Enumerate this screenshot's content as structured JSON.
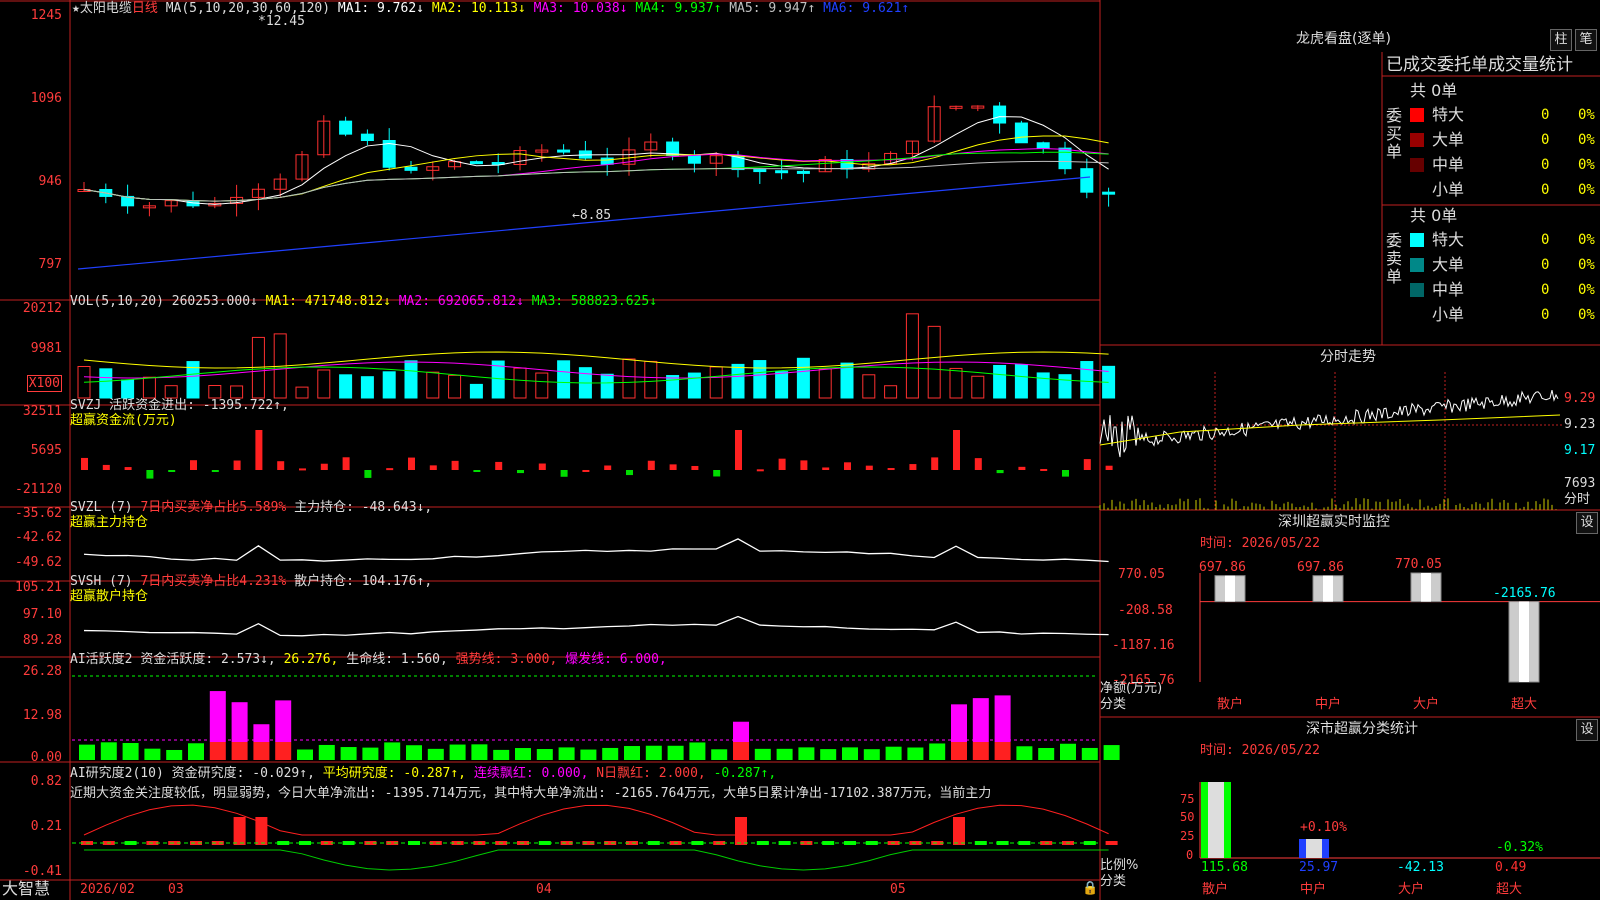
{
  "stock": {
    "name": "太阳电缆",
    "period": "日线"
  },
  "main_chart": {
    "ma_label": "MA(5,10,20,30,60,120)",
    "ma_values": [
      {
        "name": "MA1:",
        "value": "9.762↓",
        "color": "#ffffff"
      },
      {
        "name": "MA2:",
        "value": "10.113↓",
        "color": "#ffff00"
      },
      {
        "name": "MA3:",
        "value": "10.038↓",
        "color": "#ff00ff"
      },
      {
        "name": "MA4:",
        "value": "9.937↑",
        "color": "#00ff00"
      },
      {
        "name": "MA5:",
        "value": "9.947↑",
        "color": "#c0c0c0"
      },
      {
        "name": "MA6:",
        "value": "9.621↑",
        "color": "#2040ff"
      }
    ],
    "axis": [
      "1245",
      "1096",
      "946",
      "797"
    ],
    "high_label": "12.45",
    "low_label": "8.85"
  },
  "vol_panel": {
    "label": "VOL(5,10,20)",
    "value": "260253.000↓",
    "ma1": "MA1: 471748.812↓",
    "ma2": "MA2: 692065.812↓",
    "ma3": "MA3: 588823.625↓",
    "axis": [
      "20212",
      "9981"
    ],
    "unit": "X100"
  },
  "svzj_panel": {
    "line1": "SVZJ  活跃资金进出: -1395.722↑,",
    "line2": "超赢资金流(万元)",
    "axis": [
      "32511",
      "5695",
      "-21120"
    ]
  },
  "svzl_panel": {
    "prefix": "SVZL (7)",
    "ratio": "7日内买卖净占比5.589%",
    "hold": "主力持仓: -48.643↓,",
    "line2": "超赢主力持仓",
    "axis": [
      "-35.62",
      "-42.62",
      "-49.62"
    ]
  },
  "svsh_panel": {
    "prefix": "SVSH (7)",
    "ratio": "7日内买卖净占比4.231%",
    "hold": "散户持仓: 104.176↑,",
    "line2": "超赢散户持仓",
    "axis": [
      "105.21",
      "97.10",
      "89.28"
    ]
  },
  "ai_active_panel": {
    "prefix": "AI活跃度2",
    "a": "资金活跃度: 2.573↓,",
    "b": "26.276,",
    "c": "生命线: 1.560,",
    "d": "强势线: 3.000,",
    "e": "爆发线: 6.000,",
    "axis": [
      "26.28",
      "12.98",
      "0.00"
    ]
  },
  "ai_research_panel": {
    "prefix": "AI研究度2(10)",
    "a": "资金研究度: -0.029↑,",
    "b": "平均研究度: -0.287↑,",
    "c": "连续飘红: 0.000,",
    "d": "N日飘红: 2.000,",
    "e": "-0.287↑,",
    "comment": "近期大资金关注度较低，明显弱势，今日大单净流出: -1395.714万元，其中特大单净流出: -2165.764万元，大单5日累计净出-17102.387万元，当前主力",
    "axis": [
      "0.82",
      "0.21",
      "-0.41"
    ]
  },
  "date_axis": {
    "brand": "大智慧",
    "labels": [
      "2026/02",
      "03",
      "04",
      "05"
    ]
  },
  "dragon_tiger": {
    "title": "龙虎看盘(逐单)",
    "btn1": "柱",
    "btn2": "笔",
    "subtitle": "已成交委托单成交量统计",
    "buy_label": "委买单",
    "sell_label": "委卖单",
    "buy_total": "共 0单",
    "sell_total": "共 0单",
    "rows": [
      {
        "label": "特大",
        "count": "0",
        "pct": "0%",
        "buy_color": "#ff0000",
        "sell_color": "#00ffff"
      },
      {
        "label": "大单",
        "count": "0",
        "pct": "0%",
        "buy_color": "#990000",
        "sell_color": "#008888"
      },
      {
        "label": "中单",
        "count": "0",
        "pct": "0%",
        "buy_color": "#660000",
        "sell_color": "#006666"
      },
      {
        "label": "小单",
        "count": "0",
        "pct": "0%",
        "buy_color": "#000000",
        "sell_color": "#000000"
      }
    ]
  },
  "intraday": {
    "title": "分时走势",
    "axis": [
      "9.29",
      "9.23",
      "9.17"
    ],
    "vol": "7693",
    "vol_unit": "分时"
  },
  "sz_monitor": {
    "title": "深圳超赢实时监控",
    "btn": "设",
    "time": "时间: 2026/05/22",
    "axis": [
      "770.05",
      "-208.58",
      "-1187.16",
      "-2165.76"
    ],
    "ylabel": "净额(万元)",
    "xlabel": "分类",
    "bars": [
      {
        "cat": "散户",
        "value": 697.86,
        "label": "697.86"
      },
      {
        "cat": "中户",
        "value": 697.86,
        "label": "697.86"
      },
      {
        "cat": "大户",
        "value": 770.05,
        "label": "770.05"
      },
      {
        "cat": "超大",
        "value": -2165.76,
        "label": "-2165.76"
      }
    ]
  },
  "sz_category": {
    "title": "深市超赢分类统计",
    "btn": "设",
    "time": "时间: 2026/05/22",
    "axis": [
      "75",
      "50",
      "25",
      "0"
    ],
    "ylabel": "比例%",
    "xlabel": "分类",
    "cats": [
      {
        "cat": "散户",
        "value": "115.68",
        "pct": "",
        "ratio": 100,
        "color": "#00ff00"
      },
      {
        "cat": "中户",
        "value": "25.97",
        "pct": "+0.10%",
        "ratio": 25,
        "color": "#2040ff"
      },
      {
        "cat": "大户",
        "value": "-42.13",
        "pct": "",
        "ratio": 0,
        "color": "#00ffff"
      },
      {
        "cat": "超大",
        "value": "0.49",
        "pct": "-0.32%",
        "ratio": 0,
        "color": "#ff3030"
      }
    ]
  }
}
